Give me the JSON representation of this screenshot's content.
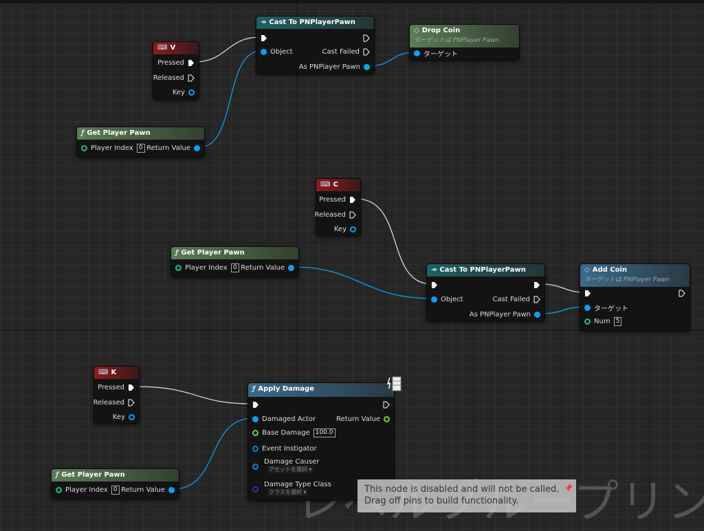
{
  "colors": {
    "exec": "#ffffff",
    "object_pin": "#0ea0f0",
    "float_pin": "#7ac943",
    "int_pin": "#1dbf8a",
    "class_pin": "#5a1fb0",
    "key_header": "#8a1c1c",
    "cast_header": "#1f5f63",
    "pure_header": "#5b7d55",
    "func_header": "#3a6a8a"
  },
  "nodes": {
    "key_v": {
      "title": "V",
      "pressed": "Pressed",
      "released": "Released",
      "key": "Key"
    },
    "key_c": {
      "title": "C",
      "pressed": "Pressed",
      "released": "Released",
      "key": "Key"
    },
    "key_k": {
      "title": "K",
      "pressed": "Pressed",
      "released": "Released",
      "key": "Key"
    },
    "cast_top": {
      "title": "Cast To PNPlayerPawn",
      "object": "Object",
      "cast_failed": "Cast Failed",
      "as_pawn": "As PNPlayer Pawn"
    },
    "cast_mid": {
      "title": "Cast To PNPlayerPawn",
      "object": "Object",
      "cast_failed": "Cast Failed",
      "as_pawn": "As PNPlayer Pawn"
    },
    "drop_coin": {
      "title": "Drop Coin",
      "subtitle": "ターゲットは PNPlayer Pawn",
      "target": "ターゲット"
    },
    "add_coin": {
      "title": "Add Coin",
      "subtitle": "ターゲットは PNPlayer Pawn",
      "target": "ターゲット",
      "num": "Num",
      "num_value": "5"
    },
    "gpp_top": {
      "title": "Get Player Pawn",
      "player_index": "Player Index",
      "index_value": "0",
      "return_value": "Return Value"
    },
    "gpp_mid": {
      "title": "Get Player Pawn",
      "player_index": "Player Index",
      "index_value": "0",
      "return_value": "Return Value"
    },
    "gpp_bottom": {
      "title": "Get Player Pawn",
      "player_index": "Player Index",
      "index_value": "0",
      "return_value": "Return Value"
    },
    "apply_damage": {
      "title": "Apply Damage",
      "damaged_actor": "Damaged Actor",
      "return_value": "Return Value",
      "base_damage": "Base Damage",
      "base_damage_value": "100.0",
      "event_instigator": "Event Instigator",
      "damage_causer": "Damage Causer",
      "damage_causer_select": "アセットを選択 ▾",
      "damage_type_class": "Damage Type Class",
      "damage_type_select": "クラスを選択 ▾"
    }
  },
  "tooltip": {
    "line1": "This node is disabled and will not be called.",
    "line2": "Drag off pins to build functionality."
  },
  "watermark": "レベルブループリント"
}
